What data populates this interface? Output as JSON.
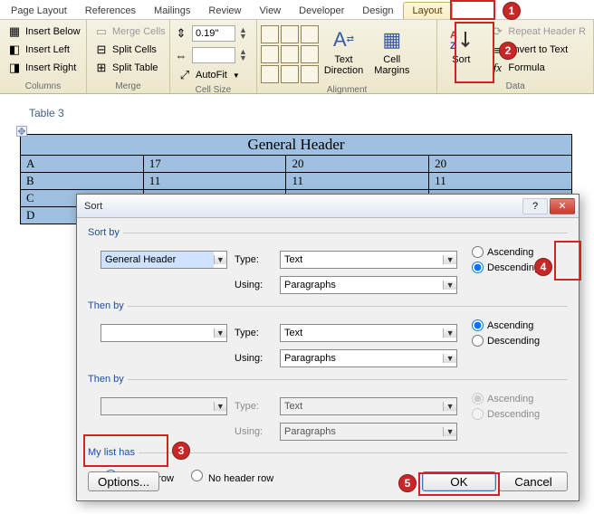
{
  "tabs": [
    "Page Layout",
    "References",
    "Mailings",
    "Review",
    "View",
    "Developer",
    "Design",
    "Layout"
  ],
  "active_tab_index": 7,
  "ribbon": {
    "columns": {
      "insert_below": "Insert Below",
      "insert_left": "Insert Left",
      "insert_right": "Insert Right",
      "group_label": "Columns"
    },
    "merge": {
      "merge_cells": "Merge Cells",
      "split_cells": "Split Cells",
      "split_table": "Split Table",
      "group_label": "Merge"
    },
    "cellsize": {
      "height_value": "0.19\"",
      "autofit": "AutoFit",
      "group_label": "Cell Size"
    },
    "alignment": {
      "text_direction": "Text\nDirection",
      "cell_margins": "Cell\nMargins",
      "group_label": "Alignment"
    },
    "data": {
      "sort": "Sort",
      "repeat_header": "Repeat Header R",
      "convert": "onvert to Text",
      "formula": "Formula",
      "group_label": "Data"
    }
  },
  "table": {
    "caption": "Table 3",
    "header": "General Header",
    "rows": [
      [
        "A",
        "17",
        "20",
        "20"
      ],
      [
        "B",
        "11",
        "11",
        "11"
      ],
      [
        "C",
        "",
        "",
        ""
      ],
      [
        "D",
        "",
        "",
        ""
      ]
    ]
  },
  "dialog": {
    "title": "Sort",
    "sort_by_legend": "Sort by",
    "then_by_legend": "Then by",
    "then_by2_legend": "Then by",
    "sort_by_field": "General Header",
    "type_label": "Type:",
    "using_label": "Using:",
    "type_value": "Text",
    "using_value": "Paragraphs",
    "ascending": "Ascending",
    "descending": "Descending",
    "list_legend": "My list has",
    "header_row": "Header row",
    "no_header_row": "No header row",
    "options": "Options...",
    "ok": "OK",
    "cancel": "Cancel"
  },
  "callouts": {
    "c1": "1",
    "c2": "2",
    "c3": "3",
    "c4": "4",
    "c5": "5"
  }
}
